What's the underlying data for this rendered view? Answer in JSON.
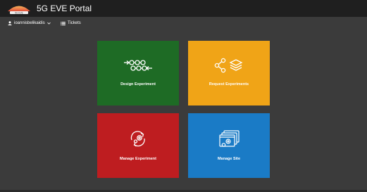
{
  "header": {
    "app_title": "5G EVE Portal",
    "logo_text": "5G EVE"
  },
  "subnav": {
    "user_label": "ioannisbelikaidis",
    "tickets_label": "Tickets"
  },
  "tiles": [
    {
      "label": "Design Experiment",
      "color": "#1e6b25",
      "icon": "workflow-icon"
    },
    {
      "label": "Request Experiments",
      "color": "#f0a417",
      "icon": "share-layers-icon"
    },
    {
      "label": "Manage Experiment",
      "color": "#be1d20",
      "icon": "settings-cycle-icon"
    },
    {
      "label": "Manage Site",
      "color": "#1a7bc6",
      "icon": "windows-gears-icon"
    }
  ]
}
